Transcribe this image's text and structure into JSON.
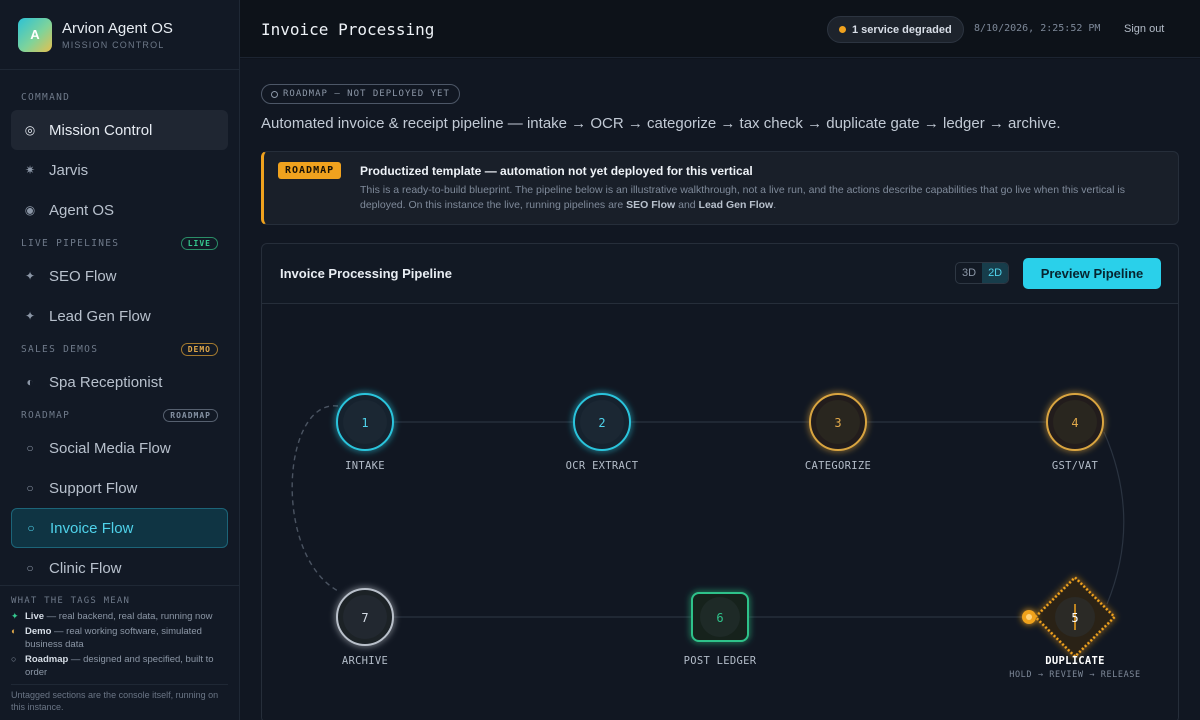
{
  "app": {
    "title": "Arvion Agent OS",
    "subtitle": "MISSION CONTROL",
    "logo_letter": "A"
  },
  "sidebar": {
    "sections": {
      "command": "COMMAND",
      "live": {
        "label": "LIVE PIPELINES",
        "tag": "LIVE"
      },
      "demos": {
        "label": "SALES DEMOS",
        "tag": "DEMO"
      },
      "roadmap": {
        "label": "ROADMAP",
        "tag": "ROADMAP"
      }
    },
    "items": {
      "mission_control": "Mission Control",
      "jarvis": "Jarvis",
      "agent_os": "Agent OS",
      "seo_flow": "SEO Flow",
      "lead_gen_flow": "Lead Gen Flow",
      "spa_receptionist": "Spa Receptionist",
      "social_media_flow": "Social Media Flow",
      "support_flow": "Support Flow",
      "invoice_flow": "Invoice Flow",
      "clinic_flow": "Clinic Flow"
    },
    "legend": {
      "title": "WHAT THE TAGS MEAN",
      "live_term": "Live",
      "live_desc": " — real backend, real data, running now",
      "demo_term": "Demo",
      "demo_desc": " — real working software, simulated business data",
      "roadmap_term": "Roadmap",
      "roadmap_desc": " — designed and specified, built to order",
      "footer": "Untagged sections are the console itself, running on this instance."
    }
  },
  "header": {
    "title": "Invoice Processing",
    "status": "1 service degraded",
    "timestamp": "8/10/2026, 2:25:52 PM",
    "signout": "Sign out"
  },
  "main": {
    "chip": "ROADMAP — NOT DEPLOYED YET",
    "subtitle": "Automated invoice & receipt pipeline — intake → OCR → categorize → tax check → duplicate gate → ledger → archive.",
    "banner": {
      "tag": "ROADMAP",
      "title": "Productized template — automation not yet deployed for this vertical",
      "body_1": "This is a ready-to-build blueprint. The pipeline below is an illustrative walkthrough, not a live run, and the actions describe capabilities that go live when this vertical is deployed. On this instance the live, running pipelines are ",
      "seo": "SEO Flow",
      "and": " and ",
      "lead": "Lead Gen Flow",
      "end": "."
    },
    "panel": {
      "title": "Invoice Processing Pipeline",
      "toggle_3d": "3D",
      "toggle_2d": "2D",
      "preview_button": "Preview Pipeline"
    },
    "pipeline": {
      "nodes": [
        {
          "num": "1",
          "label": "INTAKE",
          "status": "done",
          "color": "#2bc4dc"
        },
        {
          "num": "2",
          "label": "OCR EXTRACT",
          "status": "done",
          "color": "#2bc4dc"
        },
        {
          "num": "3",
          "label": "CATEGORIZE",
          "status": "pending",
          "color": "#d9a441"
        },
        {
          "num": "4",
          "label": "GST/VAT",
          "status": "pending",
          "color": "#d9a441"
        },
        {
          "num": "5",
          "label": "DUPLICATE",
          "sub": "HOLD → REVIEW → RELEASE",
          "status": "active",
          "color": "#f0a21e"
        },
        {
          "num": "6",
          "label": "POST LEDGER",
          "status": "success",
          "color": "#2fc28a"
        },
        {
          "num": "7",
          "label": "ARCHIVE",
          "status": "idle",
          "color": "#b9c0ca"
        }
      ]
    }
  },
  "colors": {
    "accent": "#2ad0ea",
    "warning": "#f0a21e",
    "live": "#35c98f",
    "demo": "#e0a84a"
  }
}
